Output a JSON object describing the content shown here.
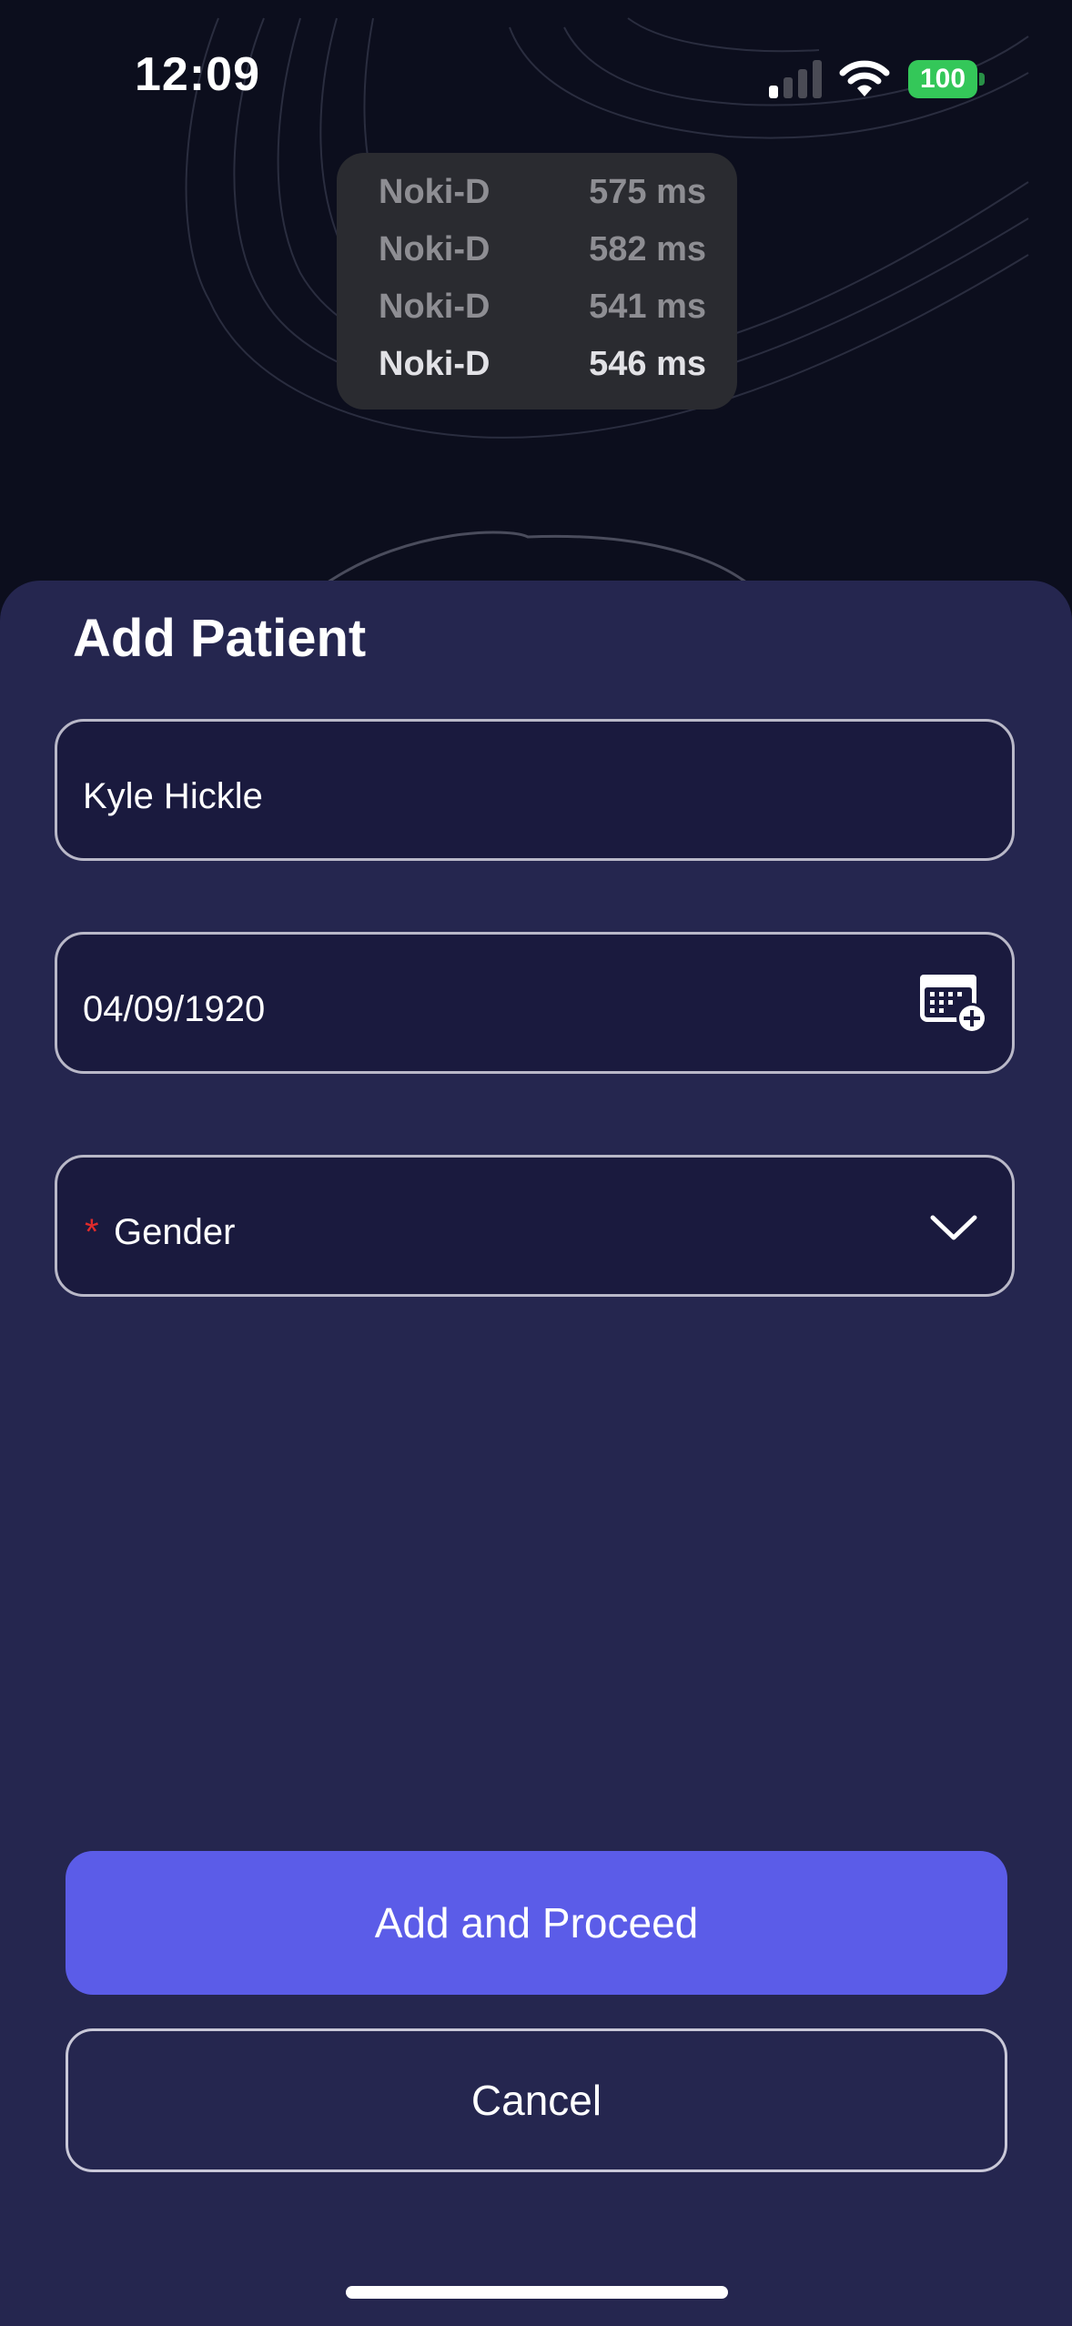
{
  "status_bar": {
    "time": "12:09",
    "battery_level": "100",
    "colors": {
      "battery": "#34c759"
    }
  },
  "latency_panel": {
    "rows": [
      {
        "name": "Noki-D",
        "latency": "575 ms"
      },
      {
        "name": "Noki-D",
        "latency": "582 ms"
      },
      {
        "name": "Noki-D",
        "latency": "541 ms"
      },
      {
        "name": "Noki-D",
        "latency": "546 ms"
      }
    ]
  },
  "sheet": {
    "title": "Add Patient",
    "name_field": {
      "value": "Kyle Hickle"
    },
    "dob_field": {
      "value": "04/09/1920",
      "icon": "calendar-add-icon"
    },
    "gender_field": {
      "required_marker": "*",
      "placeholder": "Gender",
      "icon": "chevron-down-icon"
    },
    "primary_button": "Add and Proceed",
    "secondary_button": "Cancel"
  },
  "colors": {
    "accent": "#5b5ce8",
    "sheet_bg": "#25264f",
    "field_bg": "#1a1a3e",
    "required": "#e02b2b"
  }
}
